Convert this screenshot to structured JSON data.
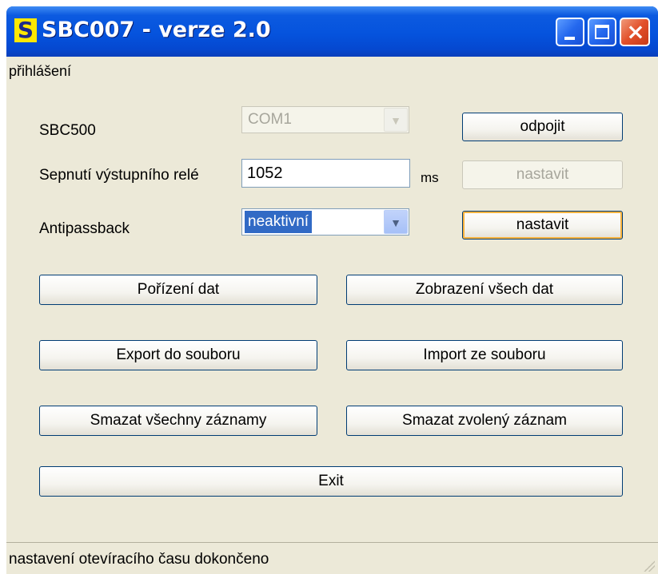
{
  "window": {
    "icon_letter": "S",
    "title": "SBC007 - verze 2.0"
  },
  "menu": {
    "items": [
      "přihlášení"
    ]
  },
  "sbc500": {
    "label": "SBC500",
    "port_value": "COM1",
    "disconnect_label": "odpojit"
  },
  "relay": {
    "label": "Sepnutí výstupního relé",
    "value": "1052",
    "unit": "ms",
    "set_label": "nastavit"
  },
  "antipassback": {
    "label": "Antipassback",
    "value": "neaktivní",
    "set_label": "nastavit"
  },
  "buttons": {
    "capture_data": "Pořízení dat",
    "show_all_data": "Zobrazení všech dat",
    "export_file": "Export do souboru",
    "import_file": "Import ze souboru",
    "delete_all": "Smazat všechny záznamy",
    "delete_selected": "Smazat zvolený záznam",
    "exit": "Exit"
  },
  "status": {
    "text": "nastavení otevíracího času dokončeno"
  },
  "colors": {
    "titlebar": "#0553dd",
    "client_bg": "#ece9d8",
    "selection": "#316ac5",
    "focus_ring": "#f8b33f"
  }
}
